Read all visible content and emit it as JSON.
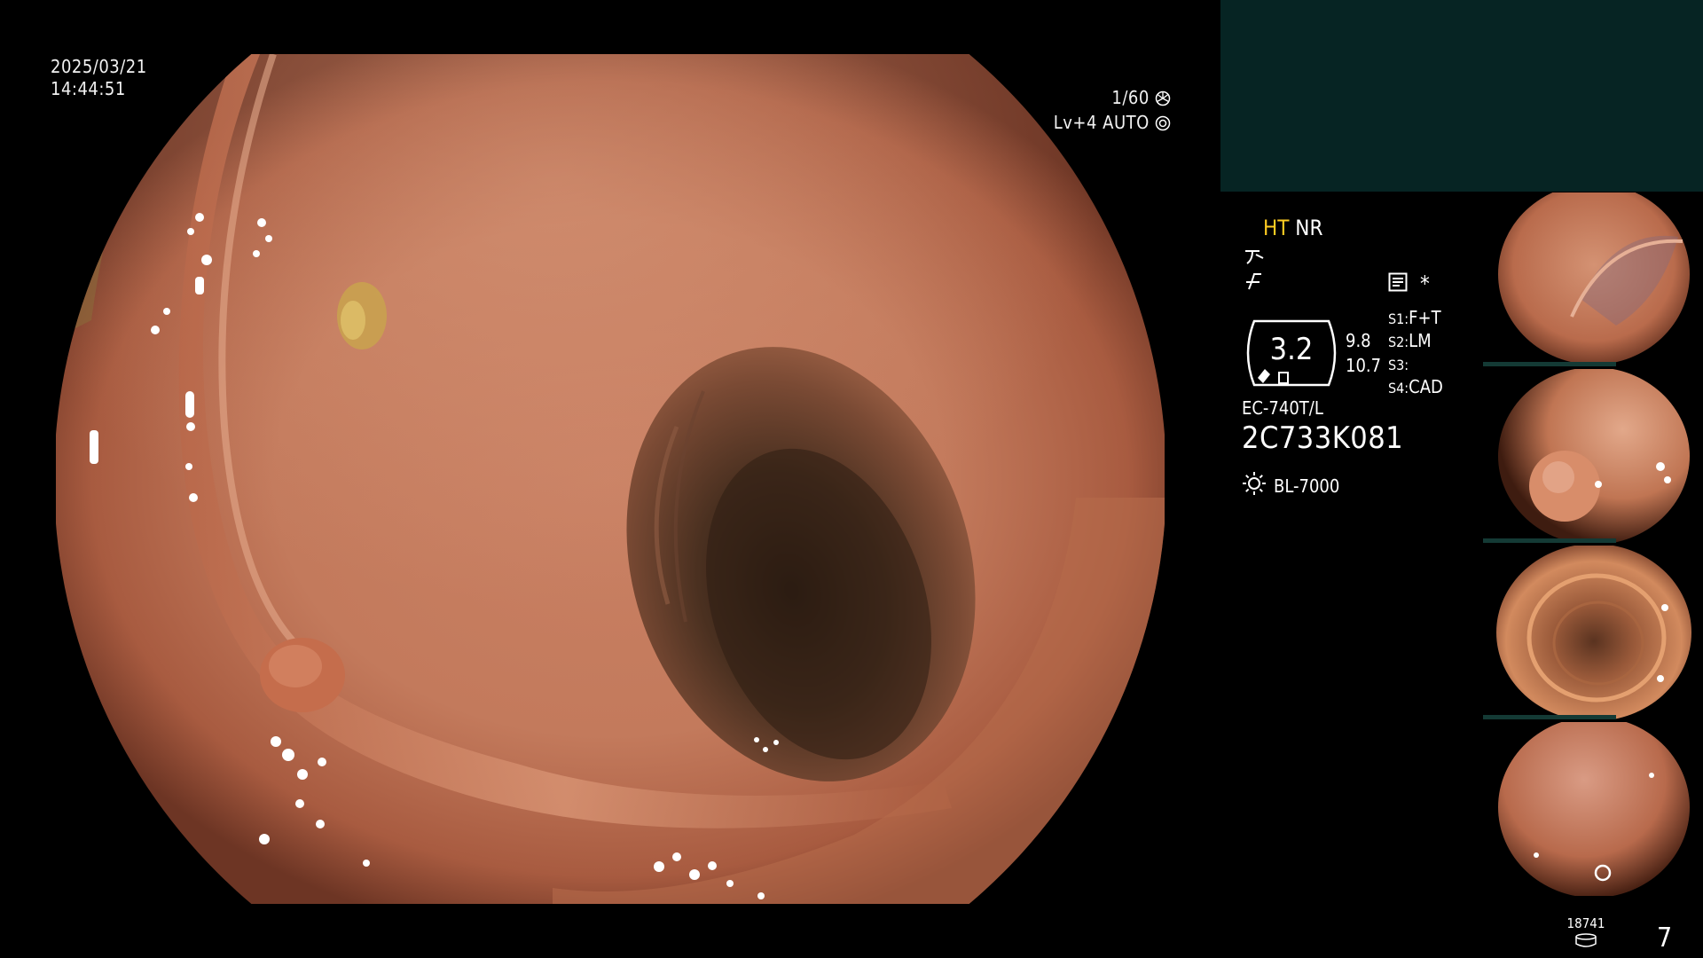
{
  "datetime": {
    "date": "2025/03/21",
    "time": "14:44:51"
  },
  "video_overlay": {
    "shutter": "1/60",
    "level": "Lv+4",
    "iris": "AUTO"
  },
  "settings": {
    "ht_label": "HT",
    "nr_label": "NR",
    "zoom_value": "3.2",
    "value_a": "9.8",
    "value_b": "10.7",
    "switches": [
      {
        "key": "S1:",
        "value": "F+T"
      },
      {
        "key": "S2:",
        "value": "LM"
      },
      {
        "key": "S3:",
        "value": ""
      },
      {
        "key": "S4:",
        "value": "CAD"
      }
    ],
    "asterisk": "*",
    "scope_model": "EC-740T/L",
    "scope_serial": "2C733K081",
    "light_source": "BL-7000"
  },
  "footer": {
    "record_count": "18741",
    "image_count": "7"
  },
  "icons": {
    "shutter": "aperture-icon",
    "iris": "gear-icon",
    "edge": "edge-enhance-icon",
    "freeze": "freeze-icon",
    "memo": "memo-icon",
    "light": "sun-icon",
    "storage": "storage-icon"
  },
  "thumbnails": [
    {
      "name": "thumbnail-1"
    },
    {
      "name": "thumbnail-2"
    },
    {
      "name": "thumbnail-3"
    },
    {
      "name": "thumbnail-4"
    }
  ]
}
